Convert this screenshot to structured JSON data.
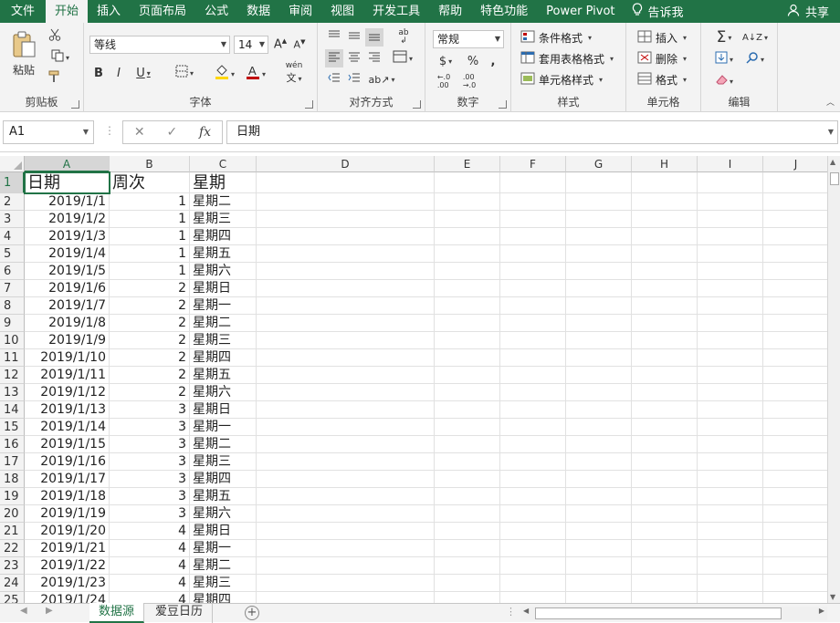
{
  "ribbon_tabs": [
    "文件",
    "开始",
    "插入",
    "页面布局",
    "公式",
    "数据",
    "审阅",
    "视图",
    "开发工具",
    "帮助",
    "特色功能",
    "Power Pivot"
  ],
  "active_tab": "开始",
  "tell_me": "告诉我",
  "share": "共享",
  "clipboard": {
    "paste": "粘贴",
    "label": "剪贴板"
  },
  "font": {
    "name": "等线",
    "size": "14",
    "label": "字体",
    "bold": "B",
    "italic": "I",
    "underline": "U",
    "phonetic": "wén"
  },
  "alignment": {
    "label": "对齐方式",
    "wrap": "ab"
  },
  "number": {
    "format": "常规",
    "label": "数字",
    "currency": "$",
    "percent": "%",
    "comma": ","
  },
  "styles": {
    "conditional": "条件格式",
    "table": "套用表格格式",
    "cell": "单元格样式",
    "label": "样式"
  },
  "cells": {
    "insert": "插入",
    "delete": "删除",
    "format": "格式",
    "label": "单元格"
  },
  "editing": {
    "label": "编辑"
  },
  "formula_bar": {
    "name_box": "A1",
    "content": "日期"
  },
  "colors": {
    "accent": "#217346",
    "font_color": "#c00000",
    "fill_color": "#ffd700"
  },
  "columns": [
    "A",
    "B",
    "C",
    "D",
    "E",
    "F",
    "G",
    "H",
    "I",
    "J"
  ],
  "header_row": [
    "日期",
    "周次",
    "星期"
  ],
  "rows": [
    [
      "2019/1/1",
      "1",
      "星期二"
    ],
    [
      "2019/1/2",
      "1",
      "星期三"
    ],
    [
      "2019/1/3",
      "1",
      "星期四"
    ],
    [
      "2019/1/4",
      "1",
      "星期五"
    ],
    [
      "2019/1/5",
      "1",
      "星期六"
    ],
    [
      "2019/1/6",
      "2",
      "星期日"
    ],
    [
      "2019/1/7",
      "2",
      "星期一"
    ],
    [
      "2019/1/8",
      "2",
      "星期二"
    ],
    [
      "2019/1/9",
      "2",
      "星期三"
    ],
    [
      "2019/1/10",
      "2",
      "星期四"
    ],
    [
      "2019/1/11",
      "2",
      "星期五"
    ],
    [
      "2019/1/12",
      "2",
      "星期六"
    ],
    [
      "2019/1/13",
      "3",
      "星期日"
    ],
    [
      "2019/1/14",
      "3",
      "星期一"
    ],
    [
      "2019/1/15",
      "3",
      "星期二"
    ],
    [
      "2019/1/16",
      "3",
      "星期三"
    ],
    [
      "2019/1/17",
      "3",
      "星期四"
    ],
    [
      "2019/1/18",
      "3",
      "星期五"
    ],
    [
      "2019/1/19",
      "3",
      "星期六"
    ],
    [
      "2019/1/20",
      "4",
      "星期日"
    ],
    [
      "2019/1/21",
      "4",
      "星期一"
    ],
    [
      "2019/1/22",
      "4",
      "星期二"
    ],
    [
      "2019/1/23",
      "4",
      "星期三"
    ],
    [
      "2019/1/24",
      "4",
      "星期四"
    ]
  ],
  "sheet_tabs": [
    "数据源",
    "爱豆日历"
  ],
  "active_sheet": "数据源"
}
